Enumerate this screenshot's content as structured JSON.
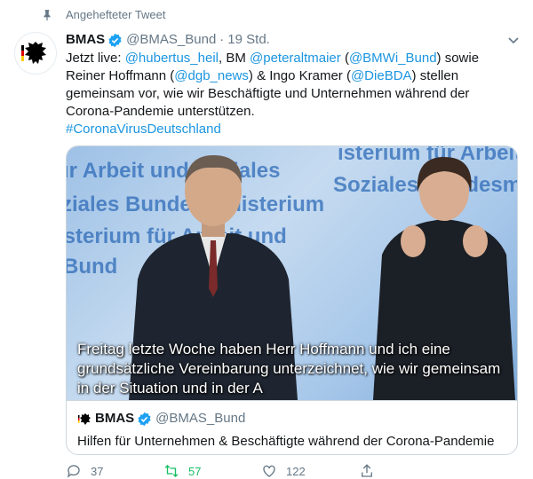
{
  "pinned": {
    "label": "Angehefteter Tweet"
  },
  "tweet": {
    "name": "BMAS",
    "handle": "@BMAS_Bund",
    "separator": "·",
    "time": "19 Std.",
    "text": {
      "l1": "Jetzt live: ",
      "m1": "@hubertus_heil",
      "l2": ",  BM ",
      "m2": "@peteraltmaier",
      "l3": " (",
      "m3": "@BMWi_Bund",
      "l4": ") sowie Reiner Hoffmann (",
      "m4": "@dgb_news",
      "l5": ") & Ingo Kramer (",
      "m5": "@DieBDA",
      "l6": ") stellen gemeinsam vor, wie wir Beschäftigte und Unternehmen während der Corona-Pandemie unterstützen.",
      "hashtag": "#CoronaVirusDeutschland"
    }
  },
  "media": {
    "wall_text": [
      "isterium für Arbeit und",
      "für Arbeit und Soziales",
      "ziales   Bundesministerium",
      "isterium für Arbeit und",
      "Bund",
      "Soziales  Bundesm"
    ],
    "subtitle": "Freitag letzte Woche haben Herr Hoffmann und ich eine grundsätzliche Vereinbarung unterzeichnet, wie wir gemeinsam in der Situation und in der A"
  },
  "quoted": {
    "name": "BMAS",
    "handle": "@BMAS_Bund",
    "title": "Hilfen für Unternehmen & Beschäftigte während der Corona-Pandemie"
  },
  "actions": {
    "replies": "37",
    "retweets": "57",
    "likes": "122"
  },
  "colors": {
    "link": "#1b95e0",
    "verified": "#1da1f2",
    "retweet": "#17bf63",
    "muted": "#657786"
  }
}
